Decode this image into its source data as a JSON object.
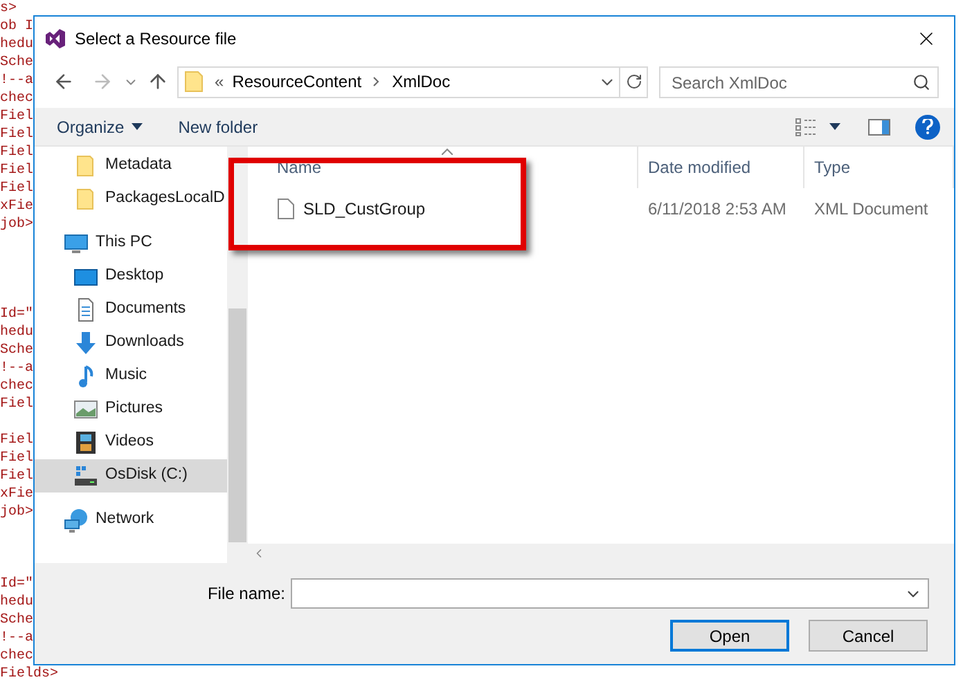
{
  "code_lines": [
    {
      "kind": "code",
      "text": "s>"
    },
    {
      "kind": "code",
      "text": "ob I"
    },
    {
      "kind": "code",
      "text": "hedu"
    },
    {
      "kind": "code",
      "text": "Sche"
    },
    {
      "kind": "code",
      "text": "!--a"
    },
    {
      "kind": "code",
      "text": "chec"
    },
    {
      "kind": "code",
      "text": "Fiel"
    },
    {
      "kind": "code",
      "text": "Fiel"
    },
    {
      "kind": "code",
      "text": "Fiel"
    },
    {
      "kind": "code",
      "text": "Fiel"
    },
    {
      "kind": "code",
      "text": "Fiel"
    },
    {
      "kind": "code",
      "text": "xFie"
    },
    {
      "kind": "code",
      "text": "job>"
    },
    {
      "kind": "blank"
    },
    {
      "kind": "blank"
    },
    {
      "kind": "blank"
    },
    {
      "kind": "blank"
    },
    {
      "kind": "code",
      "text": "Id=\""
    },
    {
      "kind": "code",
      "text": "hedu"
    },
    {
      "kind": "code",
      "text": "Sche"
    },
    {
      "kind": "code",
      "text": "!--a"
    },
    {
      "kind": "code",
      "text": "chec"
    },
    {
      "kind": "code",
      "text": "Fiel"
    },
    {
      "kind": "blank"
    },
    {
      "kind": "code",
      "text": "Fiel"
    },
    {
      "kind": "code",
      "text": "Fiel"
    },
    {
      "kind": "code",
      "text": "Fiel"
    },
    {
      "kind": "code",
      "text": "xFie"
    },
    {
      "kind": "code",
      "text": "job>"
    },
    {
      "kind": "blank"
    },
    {
      "kind": "blank"
    },
    {
      "kind": "blank"
    },
    {
      "kind": "code",
      "text": "Id=\""
    },
    {
      "kind": "code",
      "text": "hedu"
    },
    {
      "kind": "code",
      "text": "Sche"
    },
    {
      "kind": "code",
      "text": "!--a"
    },
    {
      "kind": "code",
      "text": "chec"
    },
    {
      "kind": "code",
      "text": "Fields>"
    }
  ],
  "window": {
    "title": "Select a Resource file"
  },
  "address": {
    "overflow": "«",
    "segments": [
      "ResourceContent",
      "XmlDoc"
    ]
  },
  "search": {
    "placeholder": "Search XmlDoc"
  },
  "toolbar": {
    "organize": "Organize",
    "new_folder": "New folder"
  },
  "sidebar": {
    "items": [
      {
        "kind": "folder",
        "label": "Metadata",
        "selected": false
      },
      {
        "kind": "folder",
        "label": "PackagesLocalD",
        "selected": false
      },
      {
        "kind": "pc",
        "label": "This PC",
        "selected": false,
        "children": [
          {
            "kind": "desktop",
            "label": "Desktop",
            "selected": false
          },
          {
            "kind": "documents",
            "label": "Documents",
            "selected": false
          },
          {
            "kind": "downloads",
            "label": "Downloads",
            "selected": false
          },
          {
            "kind": "music",
            "label": "Music",
            "selected": false
          },
          {
            "kind": "pictures",
            "label": "Pictures",
            "selected": false
          },
          {
            "kind": "videos",
            "label": "Videos",
            "selected": false
          },
          {
            "kind": "disk",
            "label": "OsDisk (C:)",
            "selected": true
          }
        ]
      },
      {
        "kind": "network",
        "label": "Network",
        "selected": false
      }
    ]
  },
  "table": {
    "columns": [
      "Name",
      "Date modified",
      "Type"
    ],
    "rows": [
      {
        "name": "SLD_CustGroup",
        "date": "6/11/2018 2:53 AM",
        "type": "XML Document",
        "highlighted": true
      }
    ]
  },
  "file_name": {
    "label": "File name:"
  },
  "buttons": [
    {
      "label": "Open",
      "default": true
    },
    {
      "label": "Cancel",
      "default": false
    }
  ]
}
